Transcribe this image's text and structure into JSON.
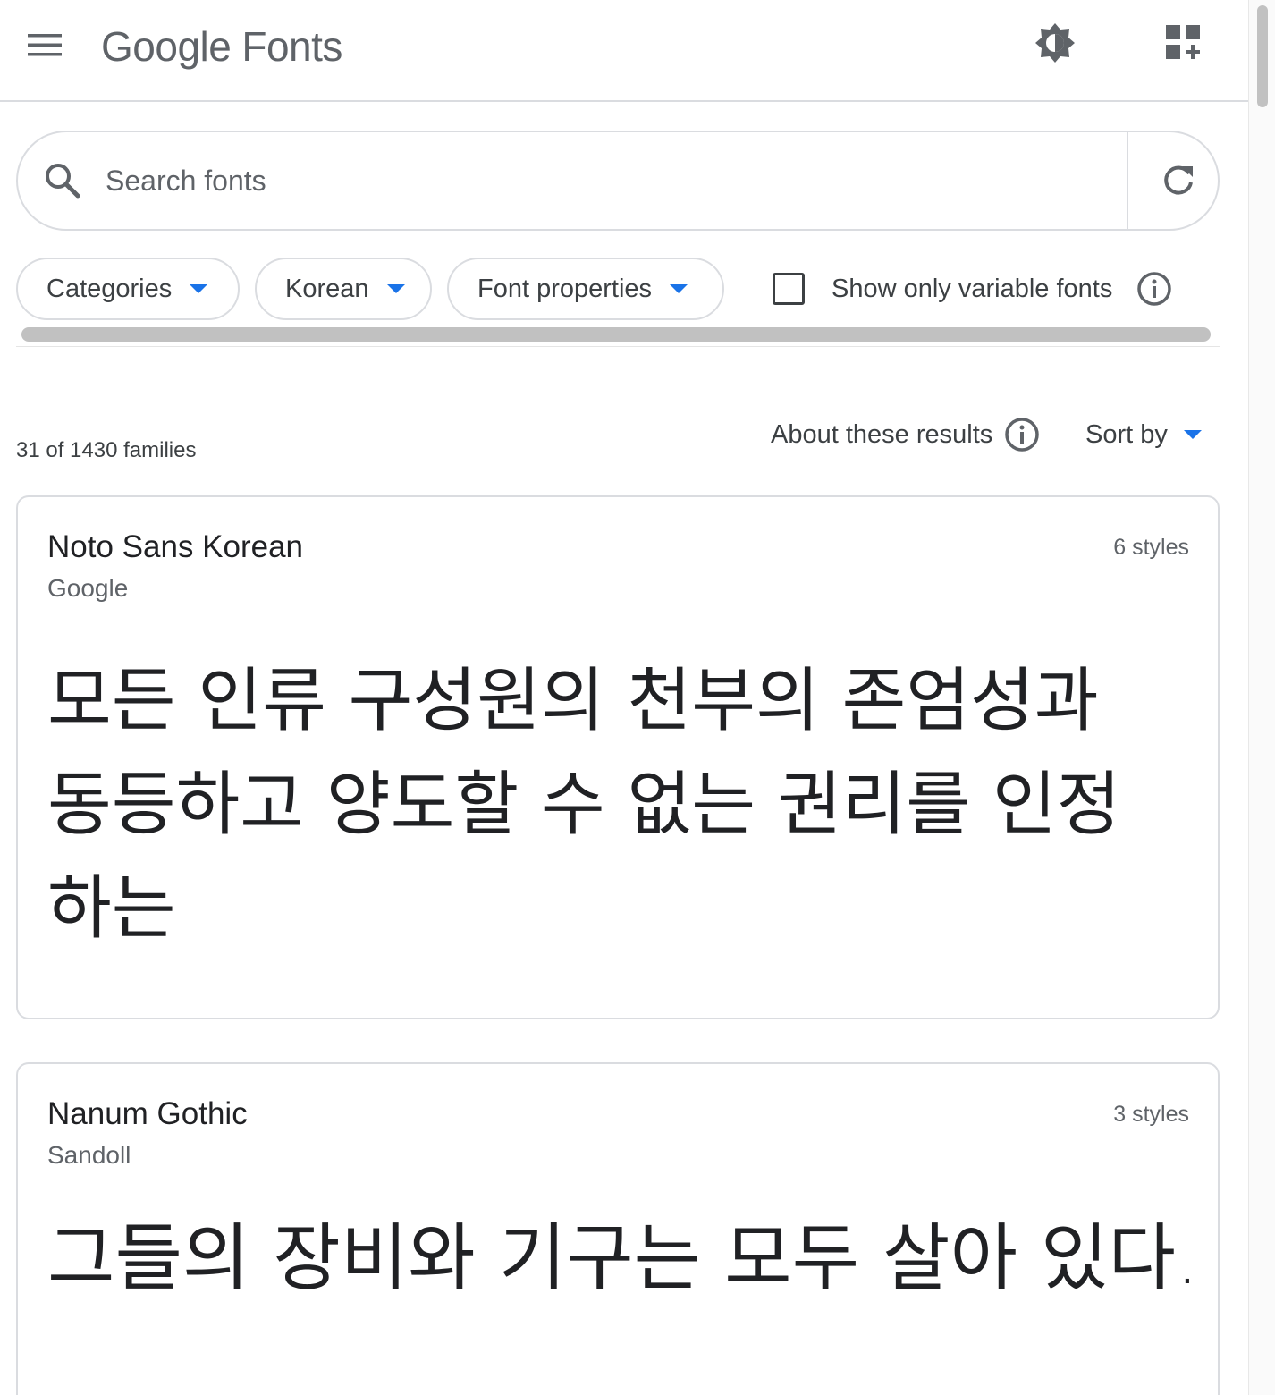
{
  "header": {
    "logo_google": "Google",
    "logo_fonts": "Fonts"
  },
  "search": {
    "placeholder": "Search fonts",
    "value": ""
  },
  "filters": {
    "categories_label": "Categories",
    "language_label": "Korean",
    "properties_label": "Font properties",
    "variable_label": "Show only variable fonts",
    "variable_checked": false
  },
  "results": {
    "count_text": "31 of 1430 families",
    "about_label": "About these results",
    "sort_label": "Sort by"
  },
  "fonts": [
    {
      "name": "Noto Sans Korean",
      "designer": "Google",
      "styles": "6 styles",
      "sample": "모든 인류 구성원의 천부의 존엄성과 동등하고 양도할 수 없는 권리를 인정하는"
    },
    {
      "name": "Nanum Gothic",
      "designer": "Sandoll",
      "styles": "3 styles",
      "sample": "그들의 장비와 기구는 모두 살아 있다."
    }
  ],
  "colors": {
    "accent": "#1a73e8",
    "text_primary": "#202124",
    "text_secondary": "#5f6368",
    "border": "#dadce0"
  },
  "icons": {
    "menu": "menu-icon",
    "theme": "brightness-icon",
    "apps": "add-widget-icon",
    "search": "search-icon",
    "refresh": "refresh-icon",
    "info": "info-icon"
  }
}
